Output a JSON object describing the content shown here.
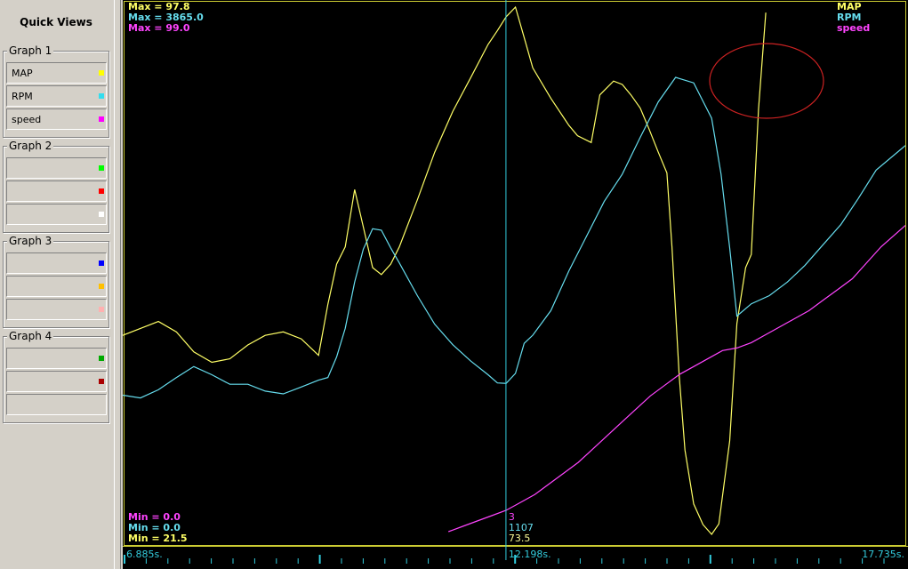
{
  "sidebar": {
    "title": "Quick Views",
    "groups": [
      {
        "title": "Graph 1",
        "channels": [
          {
            "label": "MAP",
            "color": "#ffff00"
          },
          {
            "label": "RPM",
            "color": "#33ddee"
          },
          {
            "label": "speed",
            "color": "#ff00ff"
          }
        ]
      },
      {
        "title": "Graph 2",
        "channels": [
          {
            "label": "",
            "color": "#00ff00"
          },
          {
            "label": "",
            "color": "#ff0000"
          },
          {
            "label": "",
            "color": "#ffffff"
          }
        ]
      },
      {
        "title": "Graph 3",
        "channels": [
          {
            "label": "",
            "color": "#0000ff"
          },
          {
            "label": "",
            "color": "#ffc000"
          },
          {
            "label": "",
            "color": "#ffb0b0"
          }
        ]
      },
      {
        "title": "Graph 4",
        "channels": [
          {
            "label": "",
            "color": "#00aa00"
          },
          {
            "label": "",
            "color": "#aa0000"
          }
        ]
      }
    ]
  },
  "graph": {
    "max_labels": [
      {
        "text": "Max = 97.8",
        "color": "#ffff66"
      },
      {
        "text": "Max = 3865.0",
        "color": "#66ddee"
      },
      {
        "text": "Max = 99.0",
        "color": "#ff44ff"
      }
    ],
    "min_labels": [
      {
        "text": "Min = 0.0",
        "color": "#ff44ff"
      },
      {
        "text": "Min = 0.0",
        "color": "#66ddee"
      },
      {
        "text": "Min = 21.5",
        "color": "#ffff66"
      }
    ],
    "legend": [
      {
        "text": "MAP",
        "color": "#ffff66"
      },
      {
        "text": "RPM",
        "color": "#66ddee"
      },
      {
        "text": "speed",
        "color": "#ff44ff"
      }
    ],
    "cursor": {
      "time": "12.198s.",
      "values": [
        {
          "text": "3",
          "color": "#ff44ff"
        },
        {
          "text": "1107",
          "color": "#66ddee"
        },
        {
          "text": "73.5",
          "color": "#ffff99"
        }
      ]
    },
    "time_start": "6.885s.",
    "time_end": "17.735s."
  },
  "chart_data": {
    "type": "line",
    "xlim": [
      6.885,
      17.735
    ],
    "cursor_x": 12.198,
    "series": [
      {
        "name": "MAP",
        "color": "#ffff66",
        "ylim": [
          21.5,
          97.8
        ],
        "points": [
          [
            6.885,
            50.3
          ],
          [
            7.13,
            51.3
          ],
          [
            7.38,
            52.3
          ],
          [
            7.63,
            50.8
          ],
          [
            7.87,
            47.9
          ],
          [
            8.12,
            46.4
          ],
          [
            8.37,
            46.9
          ],
          [
            8.62,
            48.9
          ],
          [
            8.86,
            50.3
          ],
          [
            9.11,
            50.8
          ],
          [
            9.36,
            49.8
          ],
          [
            9.6,
            47.4
          ],
          [
            9.73,
            54.8
          ],
          [
            9.85,
            60.6
          ],
          [
            9.97,
            63.1
          ],
          [
            10.1,
            71.4
          ],
          [
            10.22,
            66
          ],
          [
            10.35,
            60.1
          ],
          [
            10.47,
            59.1
          ],
          [
            10.6,
            60.6
          ],
          [
            10.72,
            63.1
          ],
          [
            10.97,
            69.9
          ],
          [
            11.21,
            76.8
          ],
          [
            11.46,
            82.7
          ],
          [
            11.71,
            87.6
          ],
          [
            11.95,
            92.4
          ],
          [
            12.08,
            94.4
          ],
          [
            12.2,
            96.4
          ],
          [
            12.33,
            97.8
          ],
          [
            12.45,
            93.4
          ],
          [
            12.57,
            89
          ],
          [
            12.82,
            84.6
          ],
          [
            13.07,
            80.7
          ],
          [
            13.19,
            79.2
          ],
          [
            13.38,
            78.2
          ],
          [
            13.5,
            85.1
          ],
          [
            13.69,
            87.1
          ],
          [
            13.81,
            86.6
          ],
          [
            13.93,
            85.1
          ],
          [
            14.06,
            83.2
          ],
          [
            14.18,
            80.2
          ],
          [
            14.31,
            76.8
          ],
          [
            14.43,
            73.8
          ],
          [
            14.5,
            63.1
          ],
          [
            14.6,
            44.5
          ],
          [
            14.68,
            33.7
          ],
          [
            14.8,
            25.9
          ],
          [
            14.93,
            22.9
          ],
          [
            15.05,
            21.5
          ],
          [
            15.15,
            23
          ],
          [
            15.3,
            35
          ],
          [
            15.4,
            52
          ],
          [
            15.52,
            60.1
          ],
          [
            15.6,
            62
          ],
          [
            15.7,
            83
          ],
          [
            15.8,
            97
          ]
        ]
      },
      {
        "name": "RPM",
        "color": "#66ddee",
        "ylim": [
          0,
          3865.0
        ],
        "points": [
          [
            6.885,
            1020
          ],
          [
            7.13,
            1000
          ],
          [
            7.38,
            1060
          ],
          [
            7.63,
            1150
          ],
          [
            7.87,
            1230
          ],
          [
            8.12,
            1170
          ],
          [
            8.37,
            1100
          ],
          [
            8.62,
            1100
          ],
          [
            8.86,
            1050
          ],
          [
            9.11,
            1030
          ],
          [
            9.36,
            1080
          ],
          [
            9.6,
            1130
          ],
          [
            9.73,
            1150
          ],
          [
            9.85,
            1300
          ],
          [
            9.97,
            1510
          ],
          [
            10.1,
            1850
          ],
          [
            10.22,
            2090
          ],
          [
            10.35,
            2240
          ],
          [
            10.47,
            2230
          ],
          [
            10.6,
            2100
          ],
          [
            10.72,
            1990
          ],
          [
            10.97,
            1750
          ],
          [
            11.21,
            1540
          ],
          [
            11.46,
            1390
          ],
          [
            11.71,
            1270
          ],
          [
            11.95,
            1170
          ],
          [
            12.08,
            1110
          ],
          [
            12.2,
            1107
          ],
          [
            12.33,
            1180
          ],
          [
            12.45,
            1400
          ],
          [
            12.57,
            1460
          ],
          [
            12.82,
            1640
          ],
          [
            13.07,
            1930
          ],
          [
            13.32,
            2190
          ],
          [
            13.56,
            2440
          ],
          [
            13.81,
            2640
          ],
          [
            14.06,
            2910
          ],
          [
            14.31,
            3170
          ],
          [
            14.55,
            3350
          ],
          [
            14.8,
            3310
          ],
          [
            15.05,
            3050
          ],
          [
            15.18,
            2640
          ],
          [
            15.3,
            2100
          ],
          [
            15.4,
            1600
          ],
          [
            15.6,
            1690
          ],
          [
            15.85,
            1750
          ],
          [
            16.1,
            1850
          ],
          [
            16.34,
            1970
          ],
          [
            16.59,
            2120
          ],
          [
            16.84,
            2270
          ],
          [
            17.08,
            2460
          ],
          [
            17.33,
            2670
          ],
          [
            17.735,
            2850
          ]
        ]
      },
      {
        "name": "speed",
        "color": "#ff44ff",
        "ylim": [
          0.0,
          99.0
        ],
        "points": [
          [
            11.4,
            0.5
          ],
          [
            11.6,
            1.5
          ],
          [
            11.8,
            2.5
          ],
          [
            12.0,
            3.5
          ],
          [
            12.2,
            4.5
          ],
          [
            12.4,
            6
          ],
          [
            12.6,
            7.5
          ],
          [
            12.8,
            9.5
          ],
          [
            13.0,
            11.5
          ],
          [
            13.2,
            13.5
          ],
          [
            13.4,
            16
          ],
          [
            13.6,
            18.5
          ],
          [
            13.8,
            21
          ],
          [
            14.0,
            23.5
          ],
          [
            14.2,
            26
          ],
          [
            14.4,
            28
          ],
          [
            14.6,
            30
          ],
          [
            14.8,
            31.5
          ],
          [
            15.0,
            33
          ],
          [
            15.2,
            34.5
          ],
          [
            15.4,
            35
          ],
          [
            15.6,
            36
          ],
          [
            15.8,
            37.5
          ],
          [
            16.0,
            39
          ],
          [
            16.2,
            40.5
          ],
          [
            16.4,
            42
          ],
          [
            16.6,
            44
          ],
          [
            16.8,
            46
          ],
          [
            17.0,
            48
          ],
          [
            17.2,
            51
          ],
          [
            17.4,
            54
          ],
          [
            17.735,
            58
          ]
        ]
      }
    ]
  }
}
